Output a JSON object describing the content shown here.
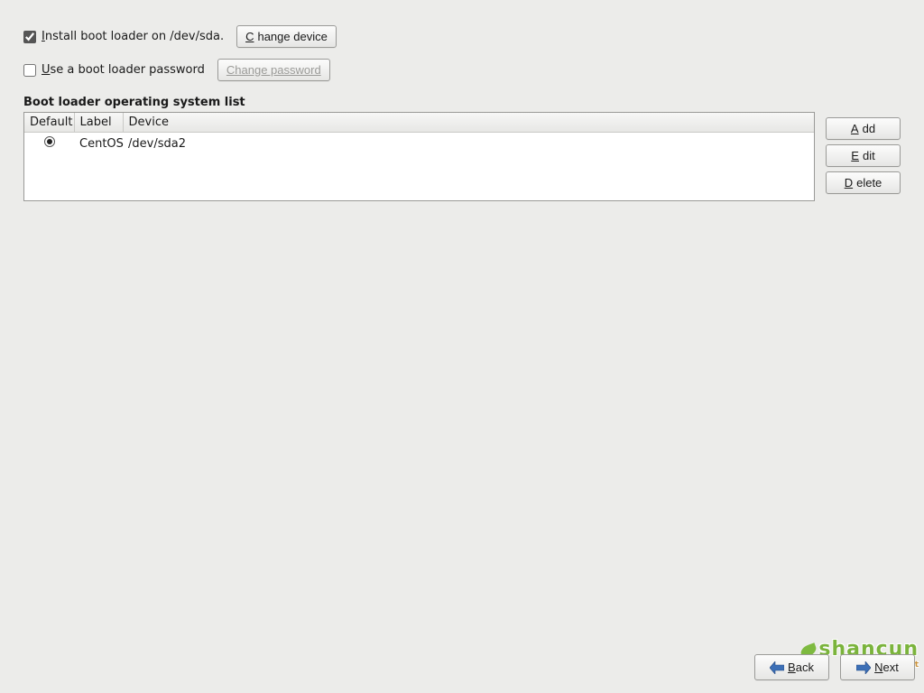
{
  "install": {
    "checked": true,
    "label_pre": "I",
    "label_rest": "nstall boot loader on /dev/sda.",
    "change_device_pre": "C",
    "change_device_rest": "hange device"
  },
  "password": {
    "checked": false,
    "label_pre": "U",
    "label_rest": "se a boot loader password",
    "change_password_label": "Change password",
    "change_password_disabled": true
  },
  "list": {
    "title": "Boot loader operating system list",
    "columns": {
      "default": "Default",
      "label": "Label",
      "device": "Device"
    },
    "rows": [
      {
        "default": true,
        "label": "CentOS",
        "device": "/dev/sda2"
      }
    ]
  },
  "side_buttons": {
    "add_pre": "A",
    "add_rest": "dd",
    "edit_pre": "E",
    "edit_rest": "dit",
    "delete_pre": "D",
    "delete_rest": "elete"
  },
  "nav": {
    "back_pre": "B",
    "back_rest": "ack",
    "next_pre": "N",
    "next_rest": "ext"
  },
  "watermark": {
    "text": "shancun",
    "sub": ".net"
  }
}
